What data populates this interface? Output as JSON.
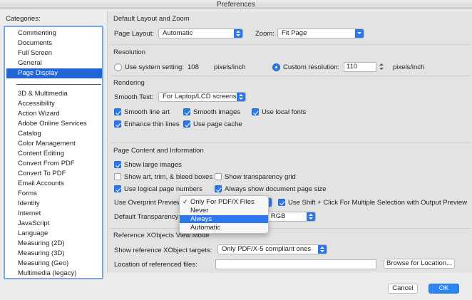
{
  "window": {
    "title": "Preferences"
  },
  "sidebar": {
    "title": "Categories:",
    "group1": [
      {
        "label": "Commenting"
      },
      {
        "label": "Documents"
      },
      {
        "label": "Full Screen"
      },
      {
        "label": "General"
      },
      {
        "label": "Page Display",
        "selected": true
      }
    ],
    "group2": [
      {
        "label": "3D & Multimedia"
      },
      {
        "label": "Accessibility"
      },
      {
        "label": "Action Wizard"
      },
      {
        "label": "Adobe Online Services"
      },
      {
        "label": "Catalog"
      },
      {
        "label": "Color Management"
      },
      {
        "label": "Content Editing"
      },
      {
        "label": "Convert From PDF"
      },
      {
        "label": "Convert To PDF"
      },
      {
        "label": "Email Accounts"
      },
      {
        "label": "Forms"
      },
      {
        "label": "Identity"
      },
      {
        "label": "Internet"
      },
      {
        "label": "JavaScript"
      },
      {
        "label": "Language"
      },
      {
        "label": "Measuring (2D)"
      },
      {
        "label": "Measuring (3D)"
      },
      {
        "label": "Measuring (Geo)"
      },
      {
        "label": "Multimedia (legacy)"
      }
    ]
  },
  "layout_zoom": {
    "title": "Default Layout and Zoom",
    "page_layout_label": "Page Layout:",
    "page_layout_value": "Automatic",
    "zoom_label": "Zoom:",
    "zoom_value": "Fit Page"
  },
  "resolution": {
    "title": "Resolution",
    "system_label": "Use system setting:",
    "system_value": "108",
    "system_unit": "pixels/inch",
    "custom_label": "Custom resolution:",
    "custom_value": "110",
    "custom_unit": "pixels/inch",
    "selected": "custom"
  },
  "rendering": {
    "title": "Rendering",
    "smooth_text_label": "Smooth Text:",
    "smooth_text_value": "For Laptop/LCD screens",
    "smooth_line_art": {
      "label": "Smooth line art",
      "checked": true
    },
    "smooth_images": {
      "label": "Smooth images",
      "checked": true
    },
    "use_local_fonts": {
      "label": "Use local fonts",
      "checked": true
    },
    "enhance_thin_lines": {
      "label": "Enhance thin lines",
      "checked": true
    },
    "use_page_cache": {
      "label": "Use page cache",
      "checked": true
    }
  },
  "page_content": {
    "title": "Page Content and Information",
    "show_large_images": {
      "label": "Show large images",
      "checked": true
    },
    "show_art_trim_bleed": {
      "label": "Show art, trim, & bleed boxes",
      "checked": false
    },
    "show_transparency_grid": {
      "label": "Show transparency grid",
      "checked": false
    },
    "use_logical_page_numbers": {
      "label": "Use logical page numbers",
      "checked": true
    },
    "always_show_page_size": {
      "label": "Always show document page size",
      "checked": true
    },
    "overprint_label": "Use Overprint Preview:",
    "shift_click": {
      "label": "Use Shift + Click For Multiple Selection with Output Preview",
      "checked": true
    },
    "transparency_label_visible": "Default Transparency B",
    "transparency_value_visible": "g RGB"
  },
  "overprint_menu": {
    "items": [
      {
        "label": "Only For PDF/X Files",
        "checked": true,
        "check": "✓"
      },
      {
        "label": "Never"
      },
      {
        "label": "Always",
        "highlighted": true
      },
      {
        "label": "Automatic"
      }
    ]
  },
  "xobjects": {
    "title": "Reference XObjects View Mode",
    "targets_label": "Show reference XObject targets:",
    "targets_value": "Only PDF/X-5 compliant ones",
    "location_label": "Location of referenced files:",
    "location_value": "",
    "browse_label": "Browse for Location..."
  },
  "footer": {
    "cancel_label": "Cancel",
    "ok_label": "OK"
  },
  "colors": {
    "accent": "#2c78ea",
    "selection": "#1f65d6",
    "list_border": "#7ca6e0"
  }
}
